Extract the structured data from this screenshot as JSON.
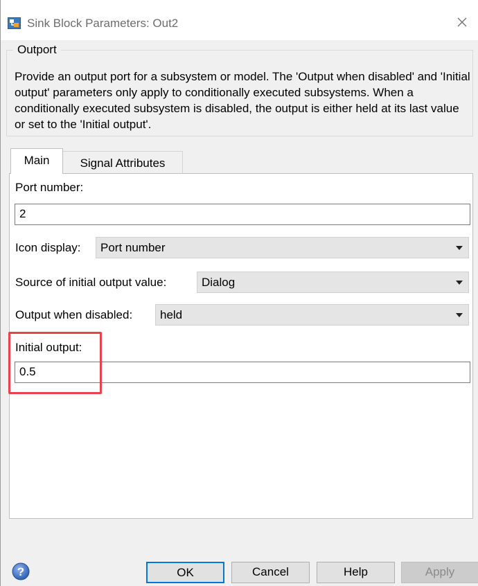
{
  "window": {
    "title": "Sink Block Parameters: Out2",
    "icons": {
      "app": "simulink-block-icon",
      "close": "close-icon",
      "help": "help-icon"
    }
  },
  "group": {
    "legend": "Outport",
    "description": "Provide an output port for a subsystem or model.  The 'Output when disabled' and 'Initial output' parameters only apply to conditionally executed subsystems. When a conditionally executed subsystem is disabled, the output is either held at its last value or set to the 'Initial output'."
  },
  "tabs": [
    {
      "label": "Main",
      "selected": true
    },
    {
      "label": "Signal Attributes",
      "selected": false
    }
  ],
  "main": {
    "port_number": {
      "label": "Port number:",
      "value": "2"
    },
    "icon_display": {
      "label": "Icon display:",
      "selected": "Port number"
    },
    "source_initial": {
      "label": "Source of initial output value:",
      "selected": "Dialog"
    },
    "output_disabled": {
      "label": "Output when disabled:",
      "selected": "held"
    },
    "initial_output": {
      "label": "Initial output:",
      "value": "0.5"
    }
  },
  "buttons": {
    "ok": "OK",
    "cancel": "Cancel",
    "help": "Help",
    "apply": "Apply"
  },
  "colors": {
    "highlight": "#e8424d",
    "default_button_border": "#0078d7"
  }
}
